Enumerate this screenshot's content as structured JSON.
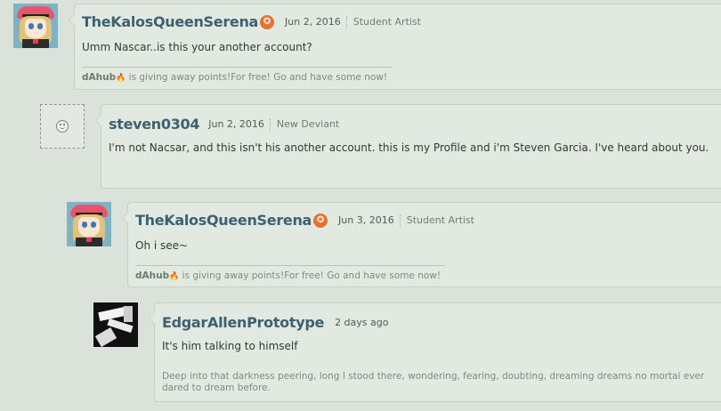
{
  "comments": [
    {
      "username": "TheKalosQueenSerena",
      "badge": "✪",
      "date": "Jun 2, 2016",
      "role": "Student Artist",
      "text": "Umm Nascar..is this your another account?",
      "sig_name": "dAhub",
      "sig_text": " is giving away points!For free! Go and have some now!"
    },
    {
      "username": "steven0304",
      "date": "Jun 2, 2016",
      "role": "New Deviant",
      "text": "I'm not Nacsar, and this isn't his another account. this is my Profile and i'm Steven Garcia. I've heard about you."
    },
    {
      "username": "TheKalosQueenSerena",
      "badge": "✪",
      "date": "Jun 3, 2016",
      "role": "Student Artist",
      "text": "Oh i see~",
      "sig_name": "dAhub",
      "sig_text": " is giving away points!For free! Go and have some now!"
    },
    {
      "username": "EdgarAllenPrototype",
      "date": "2 days ago",
      "text": "It's him talking to himself",
      "sig_text": "Deep into that darkness peering, long I stood there, wondering, fearing, doubting, dreaming dreams no mortal ever dared to dream before."
    }
  ],
  "icons": {
    "fire": "🔥",
    "smiley": "default-avatar-smiley"
  },
  "colors": {
    "background": "#dae2d9",
    "username": "#3d6170",
    "badge": "#e9712f"
  }
}
